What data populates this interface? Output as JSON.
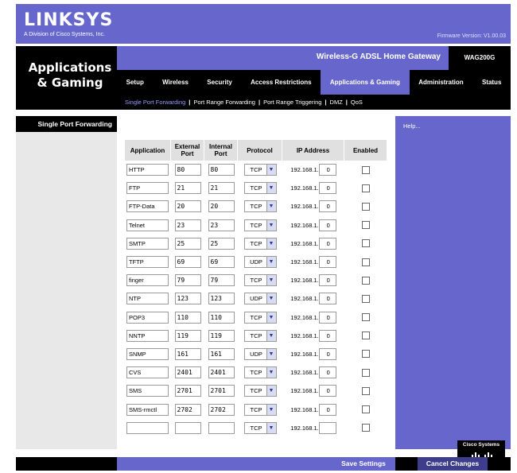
{
  "header": {
    "logo": "LINKSYS",
    "logo_sub": "A Division of Cisco Systems, Inc.",
    "firmware": "Firmware Version: V1.00.03"
  },
  "section_title": "Applications & Gaming",
  "product_name": "Wireless-G ADSL Home Gateway",
  "model": "WAG200G",
  "tabs": [
    {
      "label": "Setup"
    },
    {
      "label": "Wireless"
    },
    {
      "label": "Security"
    },
    {
      "label": "Access Restrictions"
    },
    {
      "label": "Applications & Gaming",
      "active": true
    },
    {
      "label": "Administration"
    },
    {
      "label": "Status"
    }
  ],
  "subtabs": [
    "Single Port Forwarding",
    "Port Range Forwarding",
    "Port Range Triggering",
    "DMZ",
    "QoS"
  ],
  "left_heading": "Single Port Forwarding",
  "help_link": "Help...",
  "table": {
    "headers": {
      "application": "Application",
      "external": "External Port",
      "internal": "Internal Port",
      "protocol": "Protocol",
      "ip": "IP Address",
      "enabled": "Enabled"
    },
    "ip_prefix": "192.168.1.",
    "rows": [
      {
        "app": "HTTP",
        "ext": "80",
        "int": "80",
        "proto": "TCP",
        "octet": "0"
      },
      {
        "app": "FTP",
        "ext": "21",
        "int": "21",
        "proto": "TCP",
        "octet": "0"
      },
      {
        "app": "FTP-Data",
        "ext": "20",
        "int": "20",
        "proto": "TCP",
        "octet": "0"
      },
      {
        "app": "Telnet",
        "ext": "23",
        "int": "23",
        "proto": "TCP",
        "octet": "0"
      },
      {
        "app": "SMTP",
        "ext": "25",
        "int": "25",
        "proto": "TCP",
        "octet": "0"
      },
      {
        "app": "TFTP",
        "ext": "69",
        "int": "69",
        "proto": "UDP",
        "octet": "0"
      },
      {
        "app": "finger",
        "ext": "79",
        "int": "79",
        "proto": "TCP",
        "octet": "0"
      },
      {
        "app": "NTP",
        "ext": "123",
        "int": "123",
        "proto": "UDP",
        "octet": "0"
      },
      {
        "app": "POP3",
        "ext": "110",
        "int": "110",
        "proto": "TCP",
        "octet": "0"
      },
      {
        "app": "NNTP",
        "ext": "119",
        "int": "119",
        "proto": "TCP",
        "octet": "0"
      },
      {
        "app": "SNMP",
        "ext": "161",
        "int": "161",
        "proto": "UDP",
        "octet": "0"
      },
      {
        "app": "CVS",
        "ext": "2401",
        "int": "2401",
        "proto": "TCP",
        "octet": "0"
      },
      {
        "app": "SMS",
        "ext": "2701",
        "int": "2701",
        "proto": "TCP",
        "octet": "0"
      },
      {
        "app": "SMS-rmctl",
        "ext": "2702",
        "int": "2702",
        "proto": "TCP",
        "octet": "0"
      },
      {
        "app": "",
        "ext": "",
        "int": "",
        "proto": "TCP",
        "octet": ""
      }
    ]
  },
  "buttons": {
    "save": "Save Settings",
    "cancel": "Cancel Changes"
  },
  "cisco_logo": "Cisco Systems",
  "colors": {
    "brand": "#6666cc",
    "band": "#000000",
    "active_subtab": "#9999ff"
  }
}
